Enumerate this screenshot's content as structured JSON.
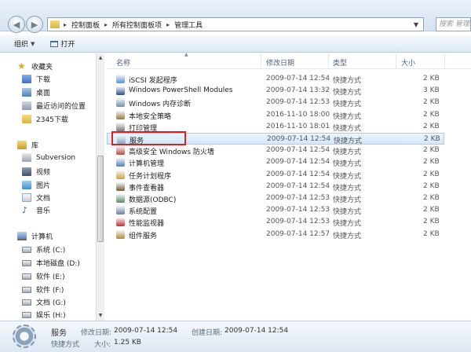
{
  "address": {
    "crumbs": [
      "控制面板",
      "所有控制面板项",
      "管理工具"
    ],
    "search_placeholder": "搜索 管理工具"
  },
  "toolbar": {
    "organize": "组织",
    "open": "打开"
  },
  "nav": {
    "favorites": {
      "label": "收藏夹",
      "items": [
        "下载",
        "桌面",
        "最近访问的位置",
        "2345下载"
      ]
    },
    "libraries": {
      "label": "库",
      "items": [
        "Subversion",
        "视频",
        "图片",
        "文档",
        "音乐"
      ]
    },
    "computer": {
      "label": "计算机",
      "items": [
        "系统 (C:)",
        "本地磁盘 (D:)",
        "软件 (E:)",
        "软件 (F:)",
        "文档 (G:)",
        "娱乐 (H:)"
      ]
    }
  },
  "columns": [
    "名称",
    "修改日期",
    "类型",
    "大小"
  ],
  "files": [
    {
      "name": "iSCSI 发起程序",
      "date": "2009-07-14 12:54",
      "type": "快捷方式",
      "size": "2 KB",
      "color": "#5a8fd6"
    },
    {
      "name": "Windows PowerShell Modules",
      "date": "2009-07-14 13:32",
      "type": "快捷方式",
      "size": "3 KB",
      "color": "#2a4f8c"
    },
    {
      "name": "Windows 内存诊断",
      "date": "2009-07-14 12:53",
      "type": "快捷方式",
      "size": "2 KB",
      "color": "#6a8fb3"
    },
    {
      "name": "本地安全策略",
      "date": "2016-11-10 18:00",
      "type": "快捷方式",
      "size": "2 KB",
      "color": "#9a7a3a"
    },
    {
      "name": "打印管理",
      "date": "2016-11-10 18:01",
      "type": "快捷方式",
      "size": "2 KB",
      "color": "#7a7a7a"
    },
    {
      "name": "服务",
      "date": "2009-07-14 12:54",
      "type": "快捷方式",
      "size": "2 KB",
      "color": "#8aa3bd",
      "selected": true
    },
    {
      "name": "高级安全 Windows 防火墙",
      "date": "2009-07-14 12:54",
      "type": "快捷方式",
      "size": "2 KB",
      "color": "#b34a3a"
    },
    {
      "name": "计算机管理",
      "date": "2009-07-14 12:54",
      "type": "快捷方式",
      "size": "2 KB",
      "color": "#4f7fb8"
    },
    {
      "name": "任务计划程序",
      "date": "2009-07-14 12:54",
      "type": "快捷方式",
      "size": "2 KB",
      "color": "#c9a23a"
    },
    {
      "name": "事件查看器",
      "date": "2009-07-14 12:54",
      "type": "快捷方式",
      "size": "2 KB",
      "color": "#7a5a3a"
    },
    {
      "name": "数据源(ODBC)",
      "date": "2009-07-14 12:53",
      "type": "快捷方式",
      "size": "2 KB",
      "color": "#5a8a5a"
    },
    {
      "name": "系统配置",
      "date": "2009-07-14 12:53",
      "type": "快捷方式",
      "size": "2 KB",
      "color": "#6a7fa0"
    },
    {
      "name": "性能监视器",
      "date": "2009-07-14 12:53",
      "type": "快捷方式",
      "size": "2 KB",
      "color": "#c03030"
    },
    {
      "name": "组件服务",
      "date": "2009-07-14 12:57",
      "type": "快捷方式",
      "size": "2 KB",
      "color": "#b08a3a"
    }
  ],
  "status": {
    "name": "服务",
    "type": "快捷方式",
    "modified_label": "修改日期:",
    "modified": "2009-07-14 12:54",
    "created_label": "创建日期:",
    "created": "2009-07-14 12:54",
    "size_label": "大小:",
    "size": "1.25 KB"
  }
}
